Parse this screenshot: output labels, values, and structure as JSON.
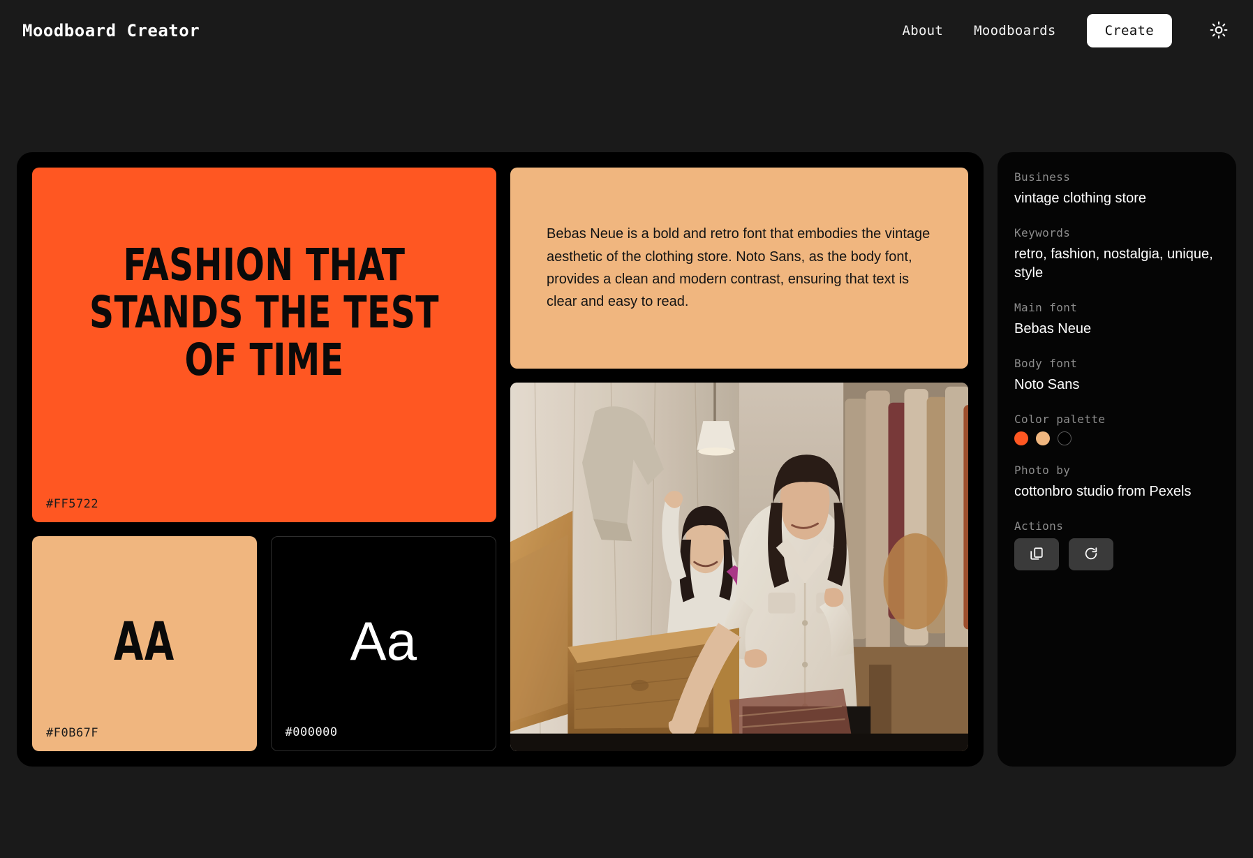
{
  "nav": {
    "brand": "Moodboard Creator",
    "links": [
      {
        "label": "About"
      },
      {
        "label": "Moodboards"
      }
    ],
    "create_label": "Create",
    "theme_icon": "sun-icon"
  },
  "board": {
    "hero": {
      "headline": "FASHION THAT STANDS THE TEST OF TIME",
      "hex": "#FF5722",
      "background": "#FF5722",
      "text_color": "#0A0A0A"
    },
    "swatches": [
      {
        "glyph": "AA",
        "hex": "#F0B67F",
        "background": "#F0B67F",
        "glyph_color": "#0A0A0A",
        "style": "display"
      },
      {
        "glyph": "Aa",
        "hex": "#000000",
        "background": "#000000",
        "glyph_color": "#FFFFFF",
        "style": "body"
      }
    ],
    "description": "Bebas Neue is a bold and retro font that embodies the vintage aesthetic of the clothing store. Noto Sans, as the body font, provides a clean and modern contrast, ensuring that text is clear and easy to read.",
    "photo_alt": "Two women browsing a wooden chest in a vintage clothing store"
  },
  "sidebar": {
    "fields": [
      {
        "label": "Business",
        "value": "vintage clothing store"
      },
      {
        "label": "Keywords",
        "value": "retro, fashion, nostalgia, unique, style"
      },
      {
        "label": "Main font",
        "value": "Bebas Neue"
      },
      {
        "label": "Body font",
        "value": "Noto Sans"
      }
    ],
    "palette_label": "Color palette",
    "palette": [
      {
        "hex": "#FF5722",
        "outlined": false
      },
      {
        "hex": "#F0B67F",
        "outlined": false
      },
      {
        "hex": "#000000",
        "outlined": true
      }
    ],
    "photo_by_label": "Photo by",
    "photo_by_value": "cottonbro studio from Pexels",
    "actions_label": "Actions",
    "actions": [
      {
        "icon": "copy-icon",
        "name": "copy-moodboard-button"
      },
      {
        "icon": "refresh-icon",
        "name": "regenerate-moodboard-button"
      }
    ]
  },
  "theme": {
    "page_background": "#1A1A1A",
    "panel_background": "#000000",
    "accent": "#FF5722",
    "secondary": "#F0B67F"
  }
}
